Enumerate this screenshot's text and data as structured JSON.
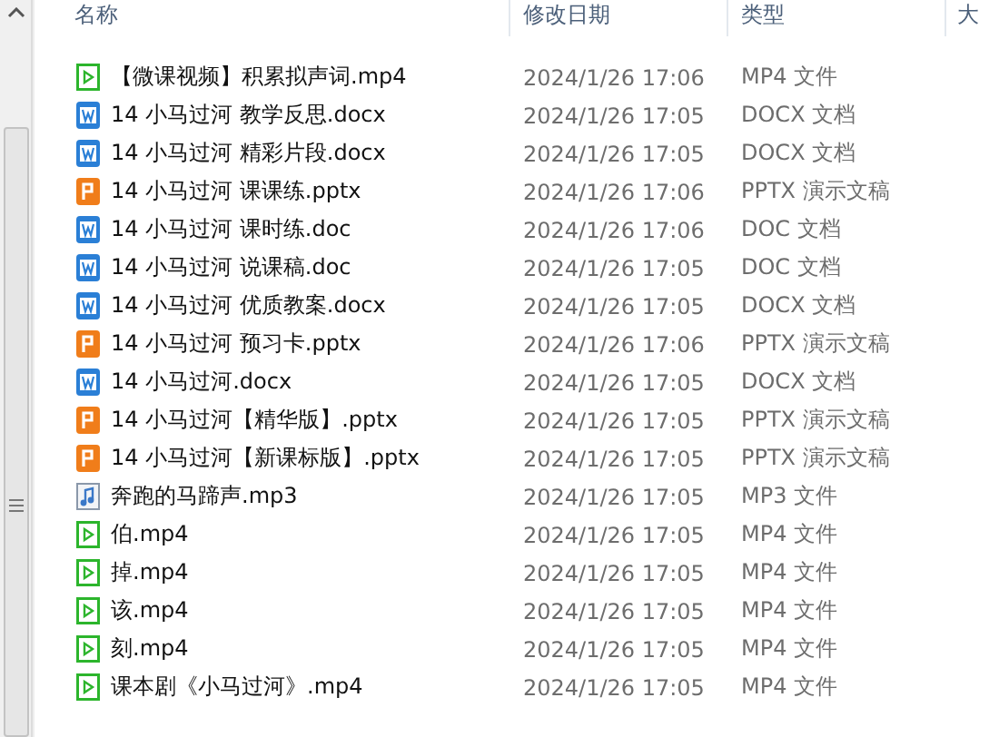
{
  "columns": [
    "名称",
    "修改日期",
    "类型",
    "大"
  ],
  "rows": [
    {
      "kind": "video",
      "name": "【微课视频】积累拟声词.mp4",
      "date": "2024/1/26 17:06",
      "type": "MP4 文件"
    },
    {
      "kind": "word",
      "name": "14 小马过河 教学反思.docx",
      "date": "2024/1/26 17:05",
      "type": "DOCX 文档"
    },
    {
      "kind": "word",
      "name": "14 小马过河 精彩片段.docx",
      "date": "2024/1/26 17:05",
      "type": "DOCX 文档"
    },
    {
      "kind": "slides",
      "name": "14 小马过河 课课练.pptx",
      "date": "2024/1/26 17:06",
      "type": "PPTX 演示文稿"
    },
    {
      "kind": "word",
      "name": "14 小马过河 课时练.doc",
      "date": "2024/1/26 17:06",
      "type": "DOC 文档"
    },
    {
      "kind": "word",
      "name": "14 小马过河 说课稿.doc",
      "date": "2024/1/26 17:05",
      "type": "DOC 文档"
    },
    {
      "kind": "word",
      "name": "14 小马过河 优质教案.docx",
      "date": "2024/1/26 17:05",
      "type": "DOCX 文档"
    },
    {
      "kind": "slides",
      "name": "14 小马过河 预习卡.pptx",
      "date": "2024/1/26 17:06",
      "type": "PPTX 演示文稿"
    },
    {
      "kind": "word",
      "name": "14 小马过河.docx",
      "date": "2024/1/26 17:05",
      "type": "DOCX 文档"
    },
    {
      "kind": "slides",
      "name": "14 小马过河【精华版】.pptx",
      "date": "2024/1/26 17:05",
      "type": "PPTX 演示文稿"
    },
    {
      "kind": "slides",
      "name": "14 小马过河【新课标版】.pptx",
      "date": "2024/1/26 17:05",
      "type": "PPTX 演示文稿"
    },
    {
      "kind": "audio",
      "name": "奔跑的马蹄声.mp3",
      "date": "2024/1/26 17:05",
      "type": "MP3 文件"
    },
    {
      "kind": "video",
      "name": "伯.mp4",
      "date": "2024/1/26 17:05",
      "type": "MP4 文件"
    },
    {
      "kind": "video",
      "name": "掉.mp4",
      "date": "2024/1/26 17:05",
      "type": "MP4 文件"
    },
    {
      "kind": "video",
      "name": "该.mp4",
      "date": "2024/1/26 17:05",
      "type": "MP4 文件"
    },
    {
      "kind": "video",
      "name": "刻.mp4",
      "date": "2024/1/26 17:05",
      "type": "MP4 文件"
    },
    {
      "kind": "video",
      "name": "课本剧《小马过河》.mp4",
      "date": "2024/1/26 17:05",
      "type": "MP4 文件"
    }
  ]
}
